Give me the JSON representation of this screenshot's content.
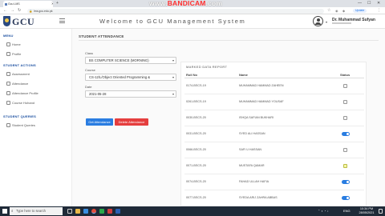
{
  "browser": {
    "tab_title": "Gcu LMS",
    "url": "lms.gcu.edu.pk",
    "profile_label": "Update",
    "recorder_watermark": "www.BANDICAM.com",
    "recorder_watermark_parts": [
      "www.",
      "BANDICAM",
      ".com"
    ]
  },
  "header": {
    "logo_text": "GCU",
    "title": "Welcome to GCU Management System",
    "user_name": "Dr. Muhammad Sufyan"
  },
  "sidebar": {
    "sections": [
      {
        "heading": "MENU",
        "items": [
          "Home",
          "Profile"
        ]
      },
      {
        "heading": "STUDENT ACTIONS",
        "items": [
          "Assessment",
          "Attendance",
          "Attendance Profile",
          "Course Hohand"
        ]
      },
      {
        "heading": "STUDENT QUERIES",
        "items": [
          "Student Queries"
        ]
      }
    ]
  },
  "main": {
    "section_title": "STUDENT ATTENDANCE",
    "form": {
      "class_label": "Class",
      "class_value": "BS COMPUTER SCIENCE (MORNING)",
      "course_label": "Course",
      "course_value": "CS-12/L/Object Oriented Programming &",
      "date_label": "Date",
      "date_value": "2021-05-28",
      "get_button": "Get Attendance",
      "delete_button": "Delete Attendance"
    },
    "report": {
      "title": "MARKED DATA REPORT",
      "columns": {
        "roll": "Roll No",
        "name": "Name",
        "status": "Status"
      },
      "rows": [
        {
          "roll": "0174-BSCS-19",
          "name": "MUHAMMAD HAMMAD ZAHEEN",
          "status": "off"
        },
        {
          "roll": "0261-BSCS-19",
          "name": "MUHAMMAD HAMMAD YOUSAF",
          "status": "off"
        },
        {
          "roll": "0030-BSCS-20",
          "name": "ISHQA SAFIAN BUKHARI",
          "status": "off"
        },
        {
          "roll": "0031-BSCS-20",
          "name": "SYED ALI HASSAN",
          "status": "on"
        },
        {
          "roll": "0066-BSCS-20",
          "name": "SAFI U HASSAN",
          "status": "off"
        },
        {
          "roll": "0071-BSCS-20",
          "name": "MUSTAFA QAMAR",
          "status": "highlight"
        },
        {
          "roll": "0074-BSCS-20",
          "name": "FAHAD ULLAH HAFIA",
          "status": "on"
        },
        {
          "roll": "0077-BSCS-20",
          "name": "SYEDA ARIJ ZAHRA ABBAS",
          "status": "on"
        }
      ]
    }
  },
  "taskbar": {
    "search_placeholder": "Type here to search",
    "lang": "ENG",
    "time": "10:34 PM",
    "date": "28/05/2021"
  },
  "colors": {
    "primary_blue": "#2a7de1",
    "danger_red": "#e53e3e",
    "sidebar_heading": "#1b4fa0",
    "watermark_red": "#ff2f2f"
  }
}
